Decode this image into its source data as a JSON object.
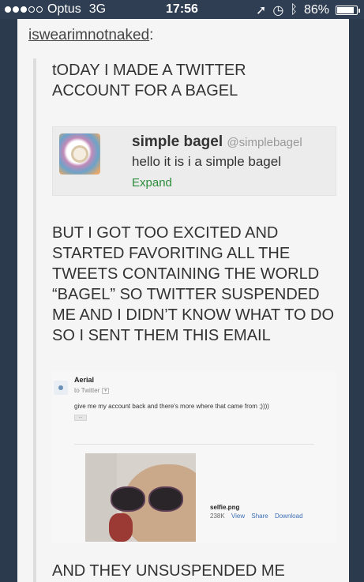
{
  "status_bar": {
    "carrier": "Optus",
    "network": "3G",
    "time": "17:56",
    "battery": "86%",
    "battery_level": 0.86,
    "signal_bars_filled": 3,
    "signal_bars_total": 5
  },
  "post": {
    "username": "iswearimnotnaked",
    "username_suffix": ":",
    "text1": "tODAY I MADE A TWITTER ACCOUNT FOR A BAGEL",
    "tweet": {
      "name": "simple bagel",
      "handle": "@simplebagel",
      "text": "hello it is i a simple bagel",
      "expand": "Expand"
    },
    "text2": "BUT I GOT TOO EXCITED AND STARTED FAVORITING ALL THE TWEETS CONTAINING THE WORLD “BAGEL” SO TWITTER SUSPENDED ME AND I DIDN’T KNOW WHAT TO DO SO I SENT THEM THIS EMAIL",
    "email": {
      "sender": "Aerial",
      "to": "to Twitter",
      "body": "give me my account back and there's more where that came from ;))))",
      "more": "...",
      "attachment": {
        "filename": "selfie.png",
        "size": "238K",
        "view": "View",
        "share": "Share",
        "download": "Download"
      }
    },
    "text3": "AND THEY UNSUSPENDED ME"
  }
}
